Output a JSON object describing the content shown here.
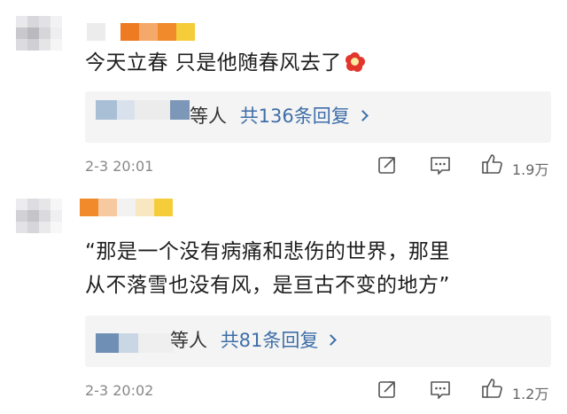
{
  "comments": [
    {
      "text": "今天立春 只是他随春风去了",
      "emoji": "red-flower-emoji",
      "reply_people": "等人",
      "reply_count": "共136条回复",
      "timestamp": "2-3 20:01",
      "likes": "1.9万"
    },
    {
      "text_line1": "“那是一个没有病痛和悲伤的世界，那里",
      "text_line2": "从不落雪也没有风，是亘古不变的地方”",
      "reply_people": "等人",
      "reply_count": "共81条回复",
      "timestamp": "2-3 20:02",
      "likes": "1.2万"
    }
  ],
  "icons": {
    "share": "share-icon",
    "comment": "comment-icon",
    "like": "thumbs-up-icon"
  },
  "colors": {
    "link_blue": "#3e6ea8",
    "reply_bg": "#f4f4f4",
    "meta_gray": "#888888",
    "name_orange": "#f08a2a",
    "name_yellow": "#f5cc3a"
  }
}
